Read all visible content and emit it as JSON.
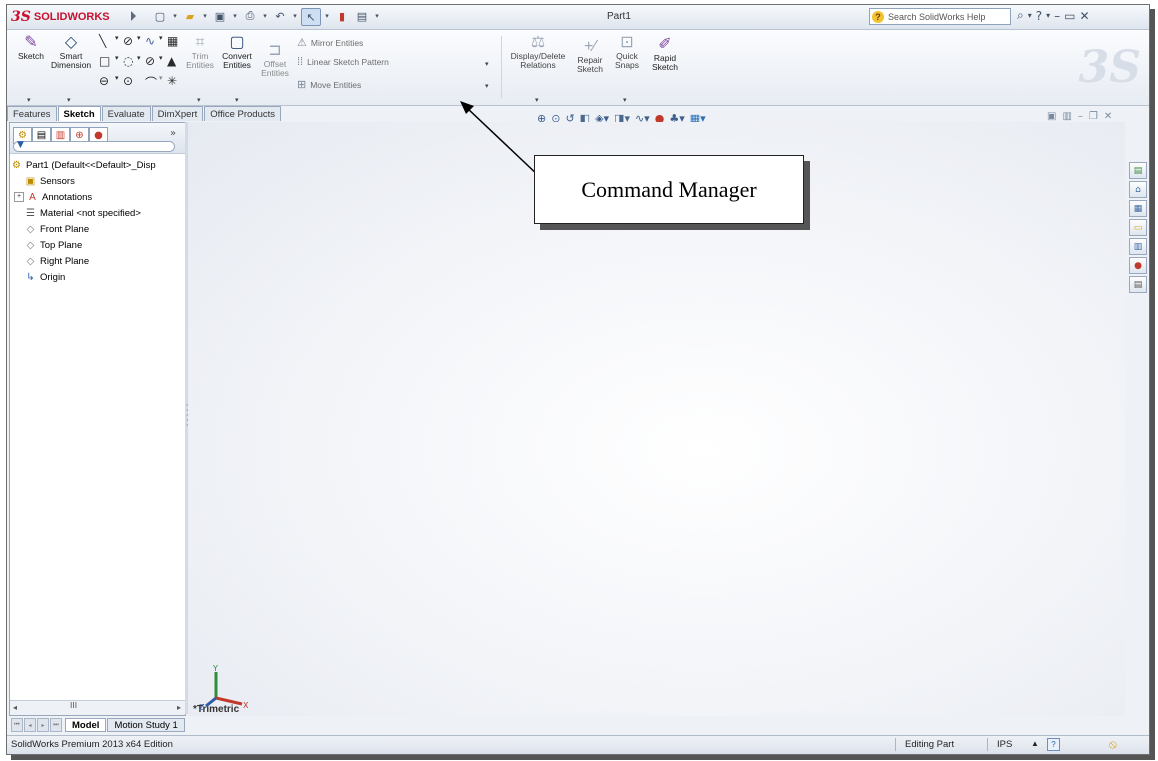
{
  "titlebar": {
    "app_name": "SOLIDWORKS",
    "logo_mark": "3S",
    "doc_title": "Part1",
    "help_search_placeholder": "Search SolidWorks Help",
    "help_icon_glyph": "?",
    "quick_access": [
      "new-icon",
      "open-icon",
      "save-icon",
      "print-icon",
      "undo-icon",
      "select-icon",
      "rebuild-icon",
      "options-icon"
    ],
    "window_buttons": [
      "search-icon",
      "help-icon",
      "minimize-icon",
      "restore-icon",
      "close-icon"
    ]
  },
  "command_manager": {
    "sketch_label": "Sketch",
    "smart_dimension_label": "Smart\nDimension",
    "trim_label": "Trim\nEntities",
    "convert_label": "Convert\nEntities",
    "offset_label": "Offset\nEntities",
    "mirror_label": "Mirror Entities",
    "linear_pattern_label": "Linear Sketch Pattern",
    "move_label": "Move Entities",
    "display_delete_label": "Display/Delete\nRelations",
    "repair_label": "Repair\nSketch",
    "quick_snaps_label": "Quick\nSnaps",
    "rapid_sketch_label": "Rapid\nSketch"
  },
  "tabs": [
    {
      "label": "Features",
      "active": false
    },
    {
      "label": "Sketch",
      "active": true
    },
    {
      "label": "Evaluate",
      "active": false
    },
    {
      "label": "DimXpert",
      "active": false
    },
    {
      "label": "Office Products",
      "active": false
    }
  ],
  "feature_tree": {
    "root": "Part1  (Default<<Default>_Disp",
    "items": [
      {
        "label": "Sensors",
        "icon": "sensors-icon",
        "expander": false
      },
      {
        "label": "Annotations",
        "icon": "annotations-icon",
        "expander": true
      },
      {
        "label": "Material <not specified>",
        "icon": "material-icon",
        "expander": false
      },
      {
        "label": "Front Plane",
        "icon": "plane-icon",
        "expander": false
      },
      {
        "label": "Top Plane",
        "icon": "plane-icon",
        "expander": false
      },
      {
        "label": "Right Plane",
        "icon": "plane-icon",
        "expander": false
      },
      {
        "label": "Origin",
        "icon": "origin-icon",
        "expander": false
      }
    ],
    "scroll_middle": "III"
  },
  "viewport": {
    "view_label": "*Trimetric",
    "triad": {
      "x": "X",
      "y": "Y",
      "z": "Z"
    }
  },
  "callout": {
    "text": "Command Manager"
  },
  "bottom_tabs": [
    {
      "label": "Model",
      "active": true
    },
    {
      "label": "Motion Study 1",
      "active": false
    }
  ],
  "statusbar": {
    "edition": "SolidWorks Premium 2013 x64 Edition",
    "mode": "Editing Part",
    "units": "IPS",
    "help_glyph": "?"
  },
  "colors": {
    "brand_red": "#c8102e",
    "ui_blue": "#2c4a74"
  }
}
